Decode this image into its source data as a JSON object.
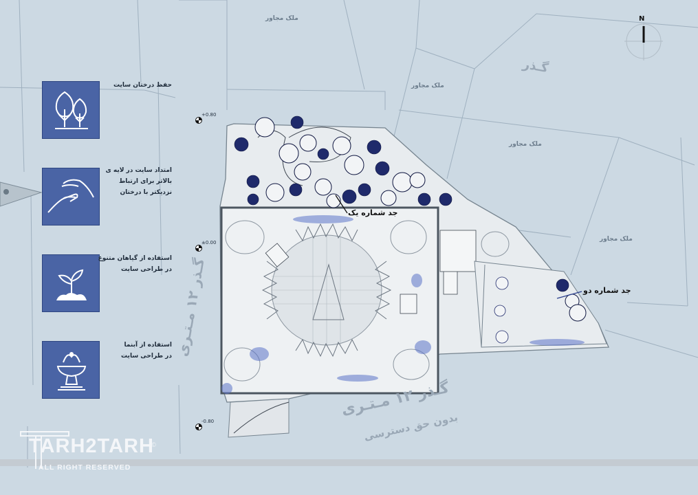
{
  "features": [
    {
      "icon": "trees-icon",
      "lines": [
        "حفظ درختان سایت"
      ]
    },
    {
      "icon": "hands-icon",
      "lines": [
        "امتداد سایت در لایه ی",
        "بالاتر برای ارتباط",
        "نزدیکتر با درختان"
      ]
    },
    {
      "icon": "sprout-icon",
      "lines": [
        "استفاده از گیاهان متنوع",
        "در طراحی سایت"
      ]
    },
    {
      "icon": "fountain-icon",
      "lines": [
        "استفاده از آبنما",
        "در طراحی سایت"
      ]
    }
  ],
  "levels": {
    "upper": "+0.80",
    "middle": "±0.00",
    "lower": "-0.80"
  },
  "neighbors": [
    "ملک مجاور",
    "ملک مجاور",
    "ملک مجاور",
    "ملک مجاور"
  ],
  "streets": {
    "top_right": "گـذر",
    "bottom_main": "گـذر ۱۲ مـتـری",
    "bottom_sub": "بدون حق دسترسی",
    "left": "گـذر ۱۲ مـتـری"
  },
  "callouts": {
    "one": "جد شماره یک",
    "two": "جد شماره دو"
  },
  "north": "N",
  "logo": {
    "main": "TARH2TARH",
    "sub": "ALL RIGHT RESERVED",
    "mark": "©"
  },
  "colors": {
    "background": "#ccd9e3",
    "card": "#4a64a5",
    "site": "#e8ecef",
    "accent": "#3b5bd0"
  }
}
